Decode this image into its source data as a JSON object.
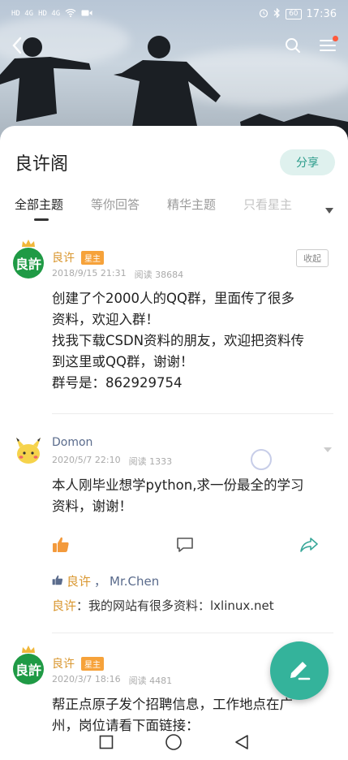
{
  "statusbar": {
    "sig1": "HD 4G",
    "sig2": "HD 4G",
    "battery": "60",
    "time": "17:36"
  },
  "group": {
    "title": "良许阁",
    "share_label": "分享"
  },
  "tabs": [
    {
      "label": "全部主题"
    },
    {
      "label": "等你回答"
    },
    {
      "label": "精华主题"
    },
    {
      "label": "只看星主"
    }
  ],
  "posts": [
    {
      "avatar_text": "良許",
      "author": "良许",
      "badge": "星主",
      "date": "2018/9/15 21:31",
      "reads": "阅读 38684",
      "collect_label": "收起",
      "lines": [
        "创建了个2000人的QQ群，里面传了很多",
        "资料，欢迎入群！",
        "找我下载CSDN资料的朋友，欢迎把资料传",
        "到这里或QQ群，谢谢！",
        "群号是：862929754"
      ]
    },
    {
      "author": "Domon",
      "date": "2020/5/7 22:10",
      "reads": "阅读 1333",
      "lines": [
        "本人刚毕业想学python,求一份最全的学习",
        "资料，谢谢！"
      ],
      "likes_owner": "良许",
      "likes_sep": "，",
      "likes_other": "Mr.Chen",
      "reply_author": "良许",
      "reply_text": "：我的网站有很多资料：lxlinux.net"
    },
    {
      "avatar_text": "良許",
      "author": "良许",
      "badge": "星主",
      "date": "2020/3/7 18:16",
      "reads": "阅读 4481",
      "lines": [
        "帮正点原子发个招聘信息，工作地点在广",
        "州，岗位请看下面链接："
      ]
    }
  ],
  "colors": {
    "accent": "#34b39b",
    "owner": "#d9962e",
    "link": "#5a6b8c"
  },
  "icons": [
    "back-icon",
    "search-icon",
    "menu-icon",
    "thumbs-up-icon",
    "comment-icon",
    "share-icon",
    "edit-icon"
  ]
}
